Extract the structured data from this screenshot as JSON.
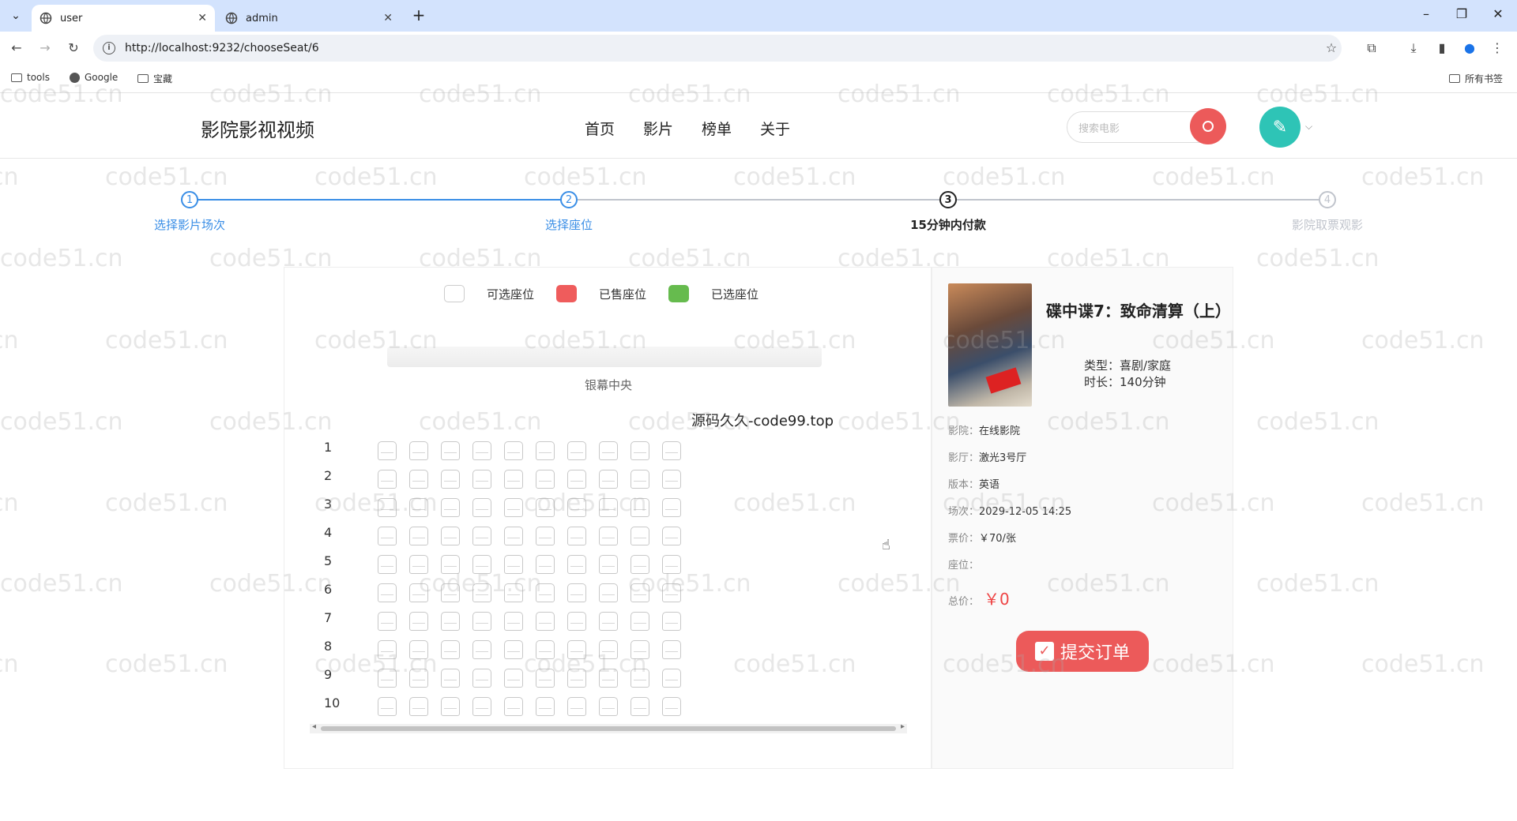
{
  "browser": {
    "tabs": [
      {
        "title": "user",
        "active": true
      },
      {
        "title": "admin",
        "active": false
      }
    ],
    "url": "http://localhost:9232/chooseSeat/6",
    "bookmarks": [
      "tools",
      "Google",
      "宝藏"
    ],
    "all_bookmarks": "所有书签"
  },
  "site": {
    "logo": "影院影视视频",
    "nav": [
      "首页",
      "影片",
      "榜单",
      "关于"
    ],
    "search_placeholder": "搜索电影"
  },
  "steps": [
    {
      "num": "1",
      "label": "选择影片场次",
      "state": "done"
    },
    {
      "num": "2",
      "label": "选择座位",
      "state": "done"
    },
    {
      "num": "3",
      "label": "15分钟内付款",
      "state": "current"
    },
    {
      "num": "4",
      "label": "影院取票观影",
      "state": "todo"
    }
  ],
  "legend": {
    "available": "可选座位",
    "sold": "已售座位",
    "selected": "已选座位"
  },
  "screen_label": "银幕中央",
  "overlay_text": "源码久久-code99.top",
  "rows": [
    "1",
    "2",
    "3",
    "4",
    "5",
    "6",
    "7",
    "8",
    "9",
    "10"
  ],
  "seats_per_row": 10,
  "movie": {
    "title": "碟中谍7：致命清算（上）",
    "genre": "类型：喜剧/家庭",
    "duration": "时长：140分钟",
    "cinema_k": "影院：",
    "cinema_v": "在线影院",
    "hall_k": "影厅：",
    "hall_v": "激光3号厅",
    "version_k": "版本：",
    "version_v": "英语",
    "showtime_k": "场次：",
    "showtime_v": "2029-12-05 14:25",
    "price_k": "票价：",
    "price_v": "￥70/张",
    "seat_k": "座位：",
    "seat_v": "",
    "total_k": "总价：",
    "total_v": "￥0"
  },
  "submit_label": "提交订单",
  "watermark": "code51.cn",
  "colors": {
    "accent": "#ec5a5a",
    "step_done": "#3a8ee6",
    "sold": "#ef5c5c",
    "selected": "#66bb4e"
  }
}
